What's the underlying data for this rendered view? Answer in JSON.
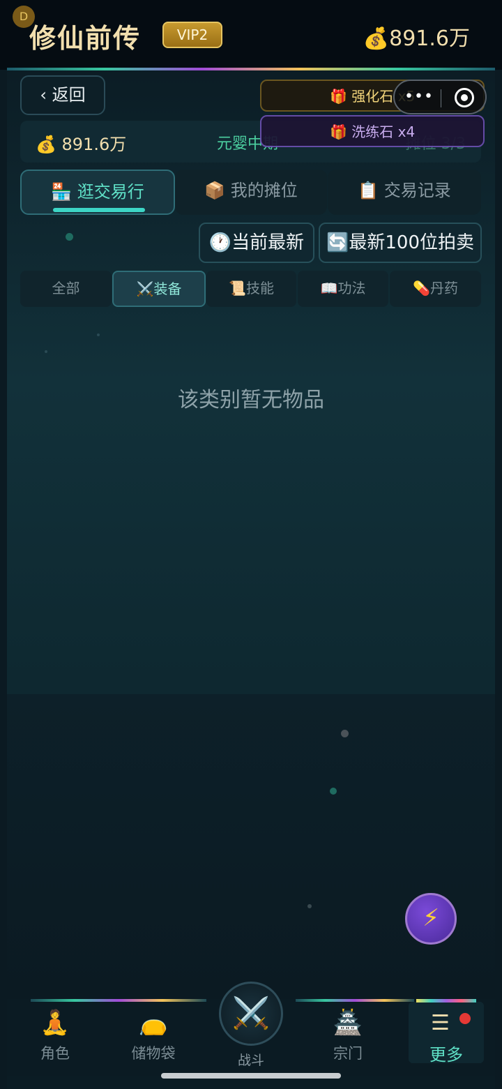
{
  "header": {
    "avatar_letter": "D",
    "title": "修仙前传",
    "vip": "VIP2",
    "gold": "💰891.6万"
  },
  "back_label": "‹ 返回",
  "info": {
    "gold": "💰 891.6万",
    "realm": "元婴中期",
    "slots": "摊位 3/3"
  },
  "toasts": [
    {
      "text": "🎁 强化石 x5"
    },
    {
      "text": "🎁 洗练石 x4"
    }
  ],
  "main_tabs": [
    {
      "label": "🏪 逛交易行"
    },
    {
      "label": "📦 我的摊位"
    },
    {
      "label": "📋 交易记录"
    }
  ],
  "sort_buttons": [
    {
      "label": "🕐当前最新"
    },
    {
      "label": "🔄最新100位拍卖"
    }
  ],
  "category_tabs": [
    {
      "label": "全部"
    },
    {
      "label": "⚔️装备"
    },
    {
      "label": "📜技能"
    },
    {
      "label": "📖功法"
    },
    {
      "label": "💊丹药"
    }
  ],
  "empty_message": "该类别暂无物品",
  "float_button_icon": "lightning-icon",
  "bottom_nav": {
    "items": [
      {
        "label": "角色",
        "icon": "meditating-figure-icon"
      },
      {
        "label": "储物袋",
        "icon": "bag-icon"
      },
      {
        "label": "战斗",
        "icon": "crossed-swords-icon"
      },
      {
        "label": "宗门",
        "icon": "temple-icon"
      },
      {
        "label": "更多",
        "icon": "menu-icon"
      }
    ]
  },
  "colors": {
    "accent": "#5fe0c6",
    "gold": "#f2dfae",
    "background": "#0b1a22"
  }
}
